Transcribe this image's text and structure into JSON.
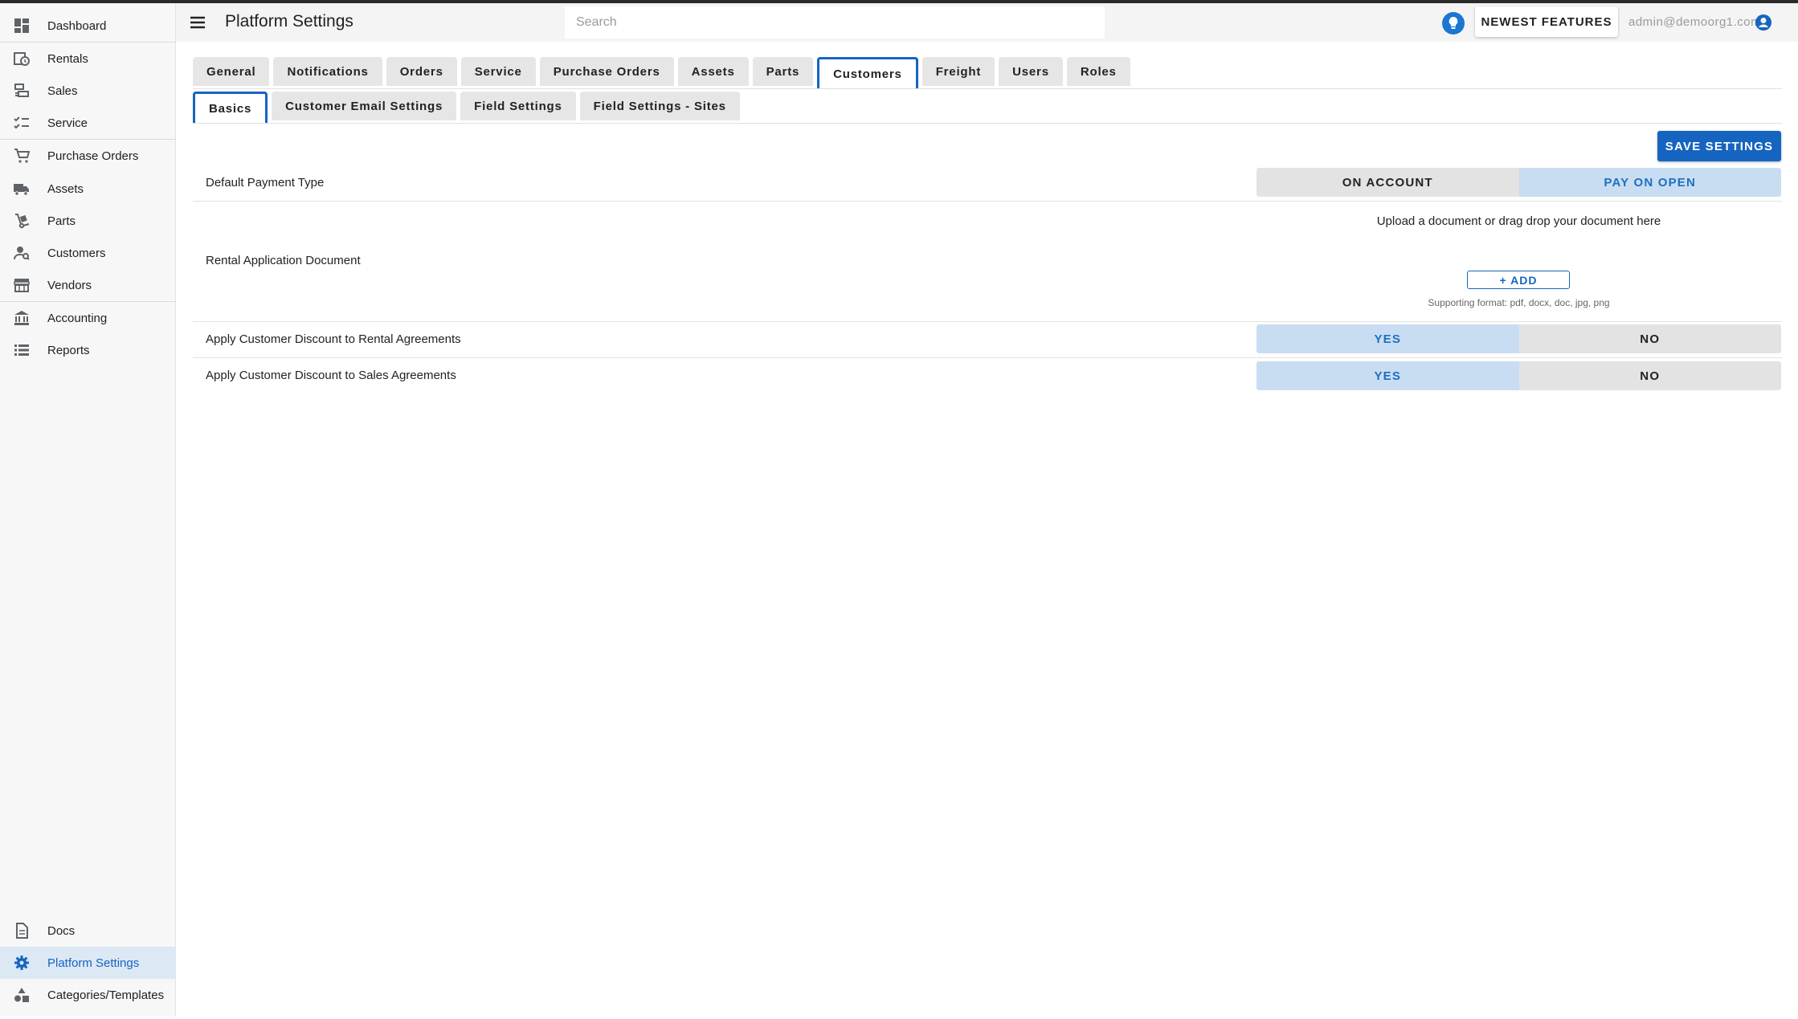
{
  "sidebar": {
    "items": [
      {
        "label": "Dashboard",
        "icon": "dashboard-icon"
      },
      {
        "label": "Rentals",
        "icon": "rentals-icon"
      },
      {
        "label": "Sales",
        "icon": "sales-icon"
      },
      {
        "label": "Service",
        "icon": "service-icon"
      },
      {
        "label": "Purchase Orders",
        "icon": "cart-icon"
      },
      {
        "label": "Assets",
        "icon": "truck-icon"
      },
      {
        "label": "Parts",
        "icon": "dolly-icon"
      },
      {
        "label": "Customers",
        "icon": "customers-icon"
      },
      {
        "label": "Vendors",
        "icon": "storefront-icon"
      },
      {
        "label": "Accounting",
        "icon": "bank-icon"
      },
      {
        "label": "Reports",
        "icon": "list-icon"
      }
    ],
    "bottom_items": [
      {
        "label": "Docs",
        "icon": "document-icon"
      },
      {
        "label": "Platform Settings",
        "icon": "gear-icon"
      },
      {
        "label": "Categories/Templates",
        "icon": "shapes-icon"
      }
    ]
  },
  "header": {
    "title": "Platform Settings",
    "search_placeholder": "Search",
    "newest_features": "NEWEST FEATURES",
    "user_email": "admin@demoorg1.com"
  },
  "tabs": [
    "General",
    "Notifications",
    "Orders",
    "Service",
    "Purchase Orders",
    "Assets",
    "Parts",
    "Customers",
    "Freight",
    "Users",
    "Roles"
  ],
  "active_tab": "Customers",
  "subtabs": [
    "Basics",
    "Customer Email Settings",
    "Field Settings",
    "Field Settings - Sites"
  ],
  "active_subtab": "Basics",
  "save_label": "SAVE SETTINGS",
  "settings": {
    "payment": {
      "label": "Default Payment Type",
      "option_a": "ON ACCOUNT",
      "option_b": "PAY ON OPEN",
      "selected": "PAY ON OPEN"
    },
    "document": {
      "label": "Rental Application Document",
      "upload_text": "Upload a document or drag drop your document here",
      "add_label": "+ ADD",
      "support_text": "Supporting format: pdf, docx, doc, jpg, png"
    },
    "rental_discount": {
      "label": "Apply Customer Discount to Rental Agreements",
      "option_a": "YES",
      "option_b": "NO",
      "selected": "YES"
    },
    "sales_discount": {
      "label": "Apply Customer Discount to Sales Agreements",
      "option_a": "YES",
      "option_b": "NO",
      "selected": "YES"
    }
  },
  "colors": {
    "accent": "#1565c0",
    "selected_option_bg": "#c9ddf2",
    "sidebar_active_bg": "#dde8f5"
  }
}
